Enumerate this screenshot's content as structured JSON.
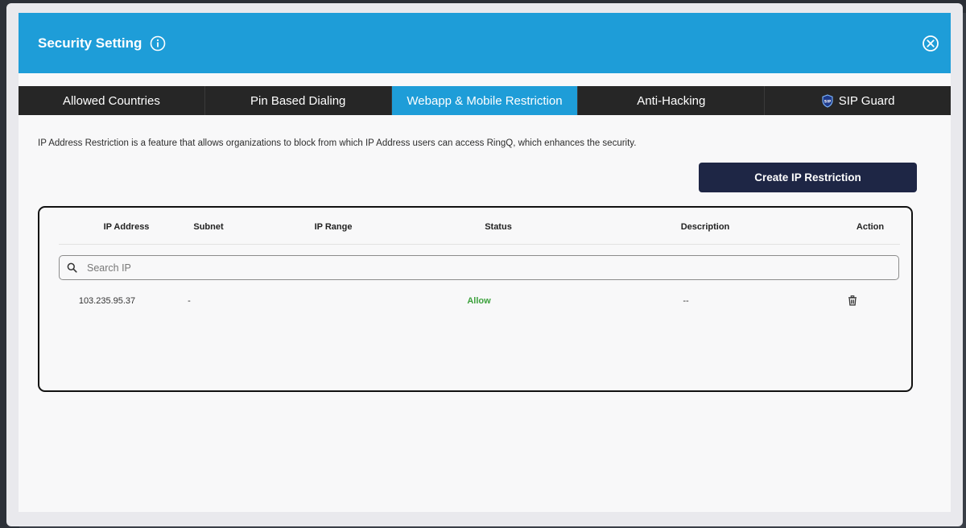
{
  "header": {
    "title": "Security Setting"
  },
  "tabs": [
    {
      "label": "Allowed Countries",
      "active": false
    },
    {
      "label": "Pin Based Dialing",
      "active": false
    },
    {
      "label": "Webapp & Mobile Restriction",
      "active": true
    },
    {
      "label": "Anti-Hacking",
      "active": false
    },
    {
      "label": "SIP Guard",
      "active": false,
      "icon": "shield-icon"
    }
  ],
  "description": "IP Address Restriction is a feature that allows organizations to block from which IP Address users can access RingQ, which enhances the security.",
  "create_button": "Create IP Restriction",
  "table": {
    "columns": [
      "IP Address",
      "Subnet",
      "IP Range",
      "Status",
      "Description",
      "Action"
    ],
    "search_placeholder": "Search IP",
    "rows": [
      {
        "ip": "103.235.95.37",
        "subnet": "-",
        "range": "",
        "status": "Allow",
        "description": "--",
        "action_icon": "trash-icon"
      }
    ]
  },
  "colors": {
    "header_bg": "#1e9dd8",
    "tab_bg": "#262626",
    "tab_active_bg": "#1e9dd8",
    "button_bg": "#1e2645",
    "status_allow": "#3ca13c"
  }
}
